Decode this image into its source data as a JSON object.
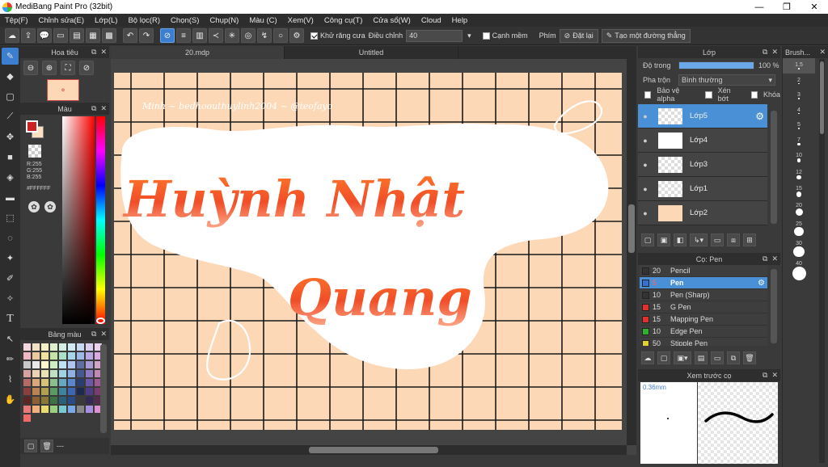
{
  "window": {
    "title": "MediBang Paint Pro (32bit)",
    "min": "—",
    "max": "❐",
    "close": "✕"
  },
  "menu": [
    "Tệp(F)",
    "Chỉnh sửa(E)",
    "Lớp(L)",
    "Bộ lọc(R)",
    "Chọn(S)",
    "Chụp(N)",
    "Màu (C)",
    "Xem(V)",
    "Công cụ(T)",
    "Cửa sổ(W)",
    "Cloud",
    "Help"
  ],
  "toolbar": {
    "antialias_label": "Khử răng cưa",
    "correction_label": "Điều chỉnh",
    "correction_value": "40",
    "smooth_edge_label": "Cạnh mềm",
    "key_label": "Phím",
    "reset_label": "Đặt lại",
    "make_straight_label": "Tạo một đường thẳng"
  },
  "navigator": {
    "title": "Hoa tiêu"
  },
  "color": {
    "title": "Màu",
    "r": "R:255",
    "g": "G:255",
    "b": "B:255",
    "hex": "#FFFFFF",
    "fg": "#cc2222",
    "bg": "#ffe0c0"
  },
  "palette": {
    "title": "Bảng màu",
    "footer": "---",
    "colors": [
      "#f6d9de",
      "#f3e1c6",
      "#f5f0c8",
      "#dff0cf",
      "#d3efe4",
      "#d1ebf4",
      "#c9d9f3",
      "#d9d0f0",
      "#ecd1ee",
      "#efb8c3",
      "#ecc99c",
      "#eee29d",
      "#c5e2a7",
      "#abe0c9",
      "#a7d6ea",
      "#9eb9e8",
      "#b9a8e4",
      "#dba8e1",
      "#c9c9c9",
      "#e9e9e9",
      "#fff6cf",
      "#cdeec0",
      "#bde2f5",
      "#aec4f2",
      "#5f6f9f",
      "#a89ad6",
      "#d4a2c9",
      "#d8a2a0",
      "#ecd2b4",
      "#e9e2b5",
      "#bfe0c2",
      "#9fd2e4",
      "#8fb0e6",
      "#445a8f",
      "#8c7bc4",
      "#c089b5",
      "#b46a66",
      "#d9a878",
      "#d8c478",
      "#8bc08e",
      "#65a8c0",
      "#5a86cf",
      "#2b3d6e",
      "#6b58a8",
      "#a05a93",
      "#8a3f3c",
      "#b98450",
      "#b3a04f",
      "#5b9a62",
      "#3f849e",
      "#3d66b3",
      "#1d2a4d",
      "#4e3d86",
      "#7d3c71",
      "#5a2725",
      "#8c5f34",
      "#8a7836",
      "#3e7143",
      "#2b607a",
      "#2a4a88",
      "#3a3a3a",
      "#332957",
      "#562a4e",
      "#ea7a7a",
      "#f0b07a",
      "#e8dc70",
      "#9ad080",
      "#7ac8d0",
      "#7aa8e8",
      "#888888",
      "#a890e0",
      "#e090d0",
      "#f06a6a"
    ]
  },
  "tabs": [
    "20.mdp",
    "Untitled"
  ],
  "canvas_art": {
    "small_text": "Minh ~ bedhoouthuylinh2004 ~ @teofayo",
    "line1": "Huỳnh Nhật",
    "line2": "Quang"
  },
  "layers": {
    "title": "Lớp",
    "opacity_label": "Độ trong",
    "opacity_value": "100 %",
    "blend_label": "Pha trộn",
    "blend_value": "Bình thường",
    "protect_alpha": "Bảo vệ alpha",
    "clipping": "Xén bớt",
    "lock": "Khóa",
    "items": [
      {
        "name": "Lớp5",
        "selected": true
      },
      {
        "name": "Lớp4",
        "selected": false
      },
      {
        "name": "Lớp3",
        "selected": false
      },
      {
        "name": "Lớp1",
        "selected": false
      },
      {
        "name": "Lớp2",
        "selected": false
      }
    ]
  },
  "brushes": {
    "title": "Cọ: Pen",
    "items": [
      {
        "size": "20",
        "name": "Pencil",
        "color": "#333333",
        "selected": false
      },
      {
        "size": "5",
        "name": "Pen",
        "color": "#3a6fd0",
        "selected": true
      },
      {
        "size": "10",
        "name": "Pen (Sharp)",
        "color": "#333333",
        "selected": false
      },
      {
        "size": "15",
        "name": "G Pen",
        "color": "#e03030",
        "selected": false
      },
      {
        "size": "15",
        "name": "Mapping Pen",
        "color": "#e03030",
        "selected": false
      },
      {
        "size": "10",
        "name": "Edge Pen",
        "color": "#30b030",
        "selected": false
      },
      {
        "size": "50",
        "name": "Stipple Pen",
        "color": "#e0d030",
        "selected": false
      }
    ]
  },
  "preview": {
    "title": "Xem trước cọ",
    "size": "0.36mm"
  },
  "brush_size": {
    "title": "Brush...",
    "sizes": [
      "1.5",
      "2",
      "3",
      "4",
      "5",
      "7",
      "10",
      "12",
      "15",
      "20",
      "25",
      "30",
      "40"
    ]
  }
}
